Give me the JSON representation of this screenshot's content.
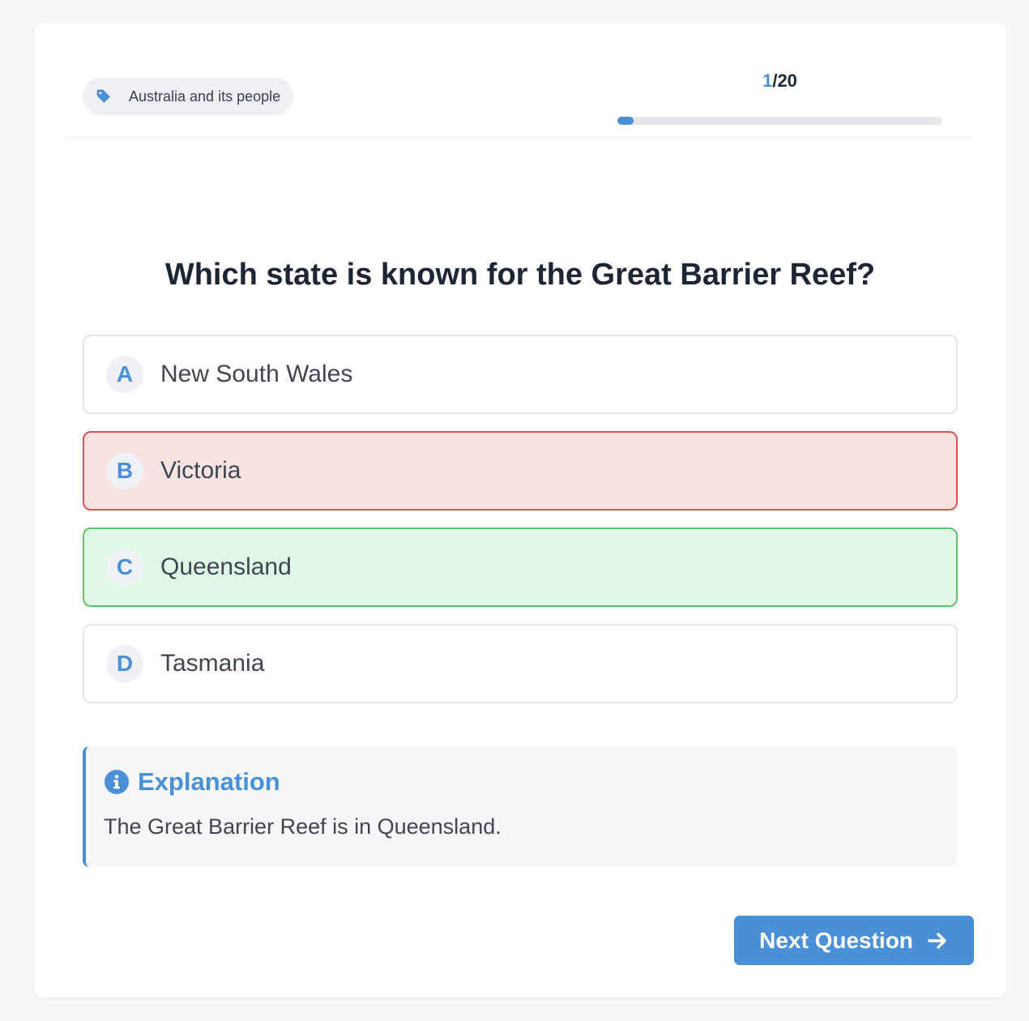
{
  "category": {
    "icon": "tag-icon",
    "label": "Australia and its people"
  },
  "progress": {
    "current": "1",
    "separator": "/",
    "total": "20",
    "fraction": 0.05
  },
  "question": "Which state is known for the Great Barrier Reef?",
  "options": [
    {
      "letter": "A",
      "text": "New South Wales",
      "state": "default"
    },
    {
      "letter": "B",
      "text": "Victoria",
      "state": "incorrect"
    },
    {
      "letter": "C",
      "text": "Queensland",
      "state": "correct"
    },
    {
      "letter": "D",
      "text": "Tasmania",
      "state": "default"
    }
  ],
  "explanation": {
    "icon": "info-icon",
    "title": "Explanation",
    "text": "The Great Barrier Reef is in Queensland."
  },
  "next_button": {
    "label": "Next Question",
    "icon": "arrow-right-icon"
  },
  "colors": {
    "accent": "#4a90d9",
    "incorrect_bg": "#f8e3e2",
    "incorrect_border": "#dc5250",
    "correct_bg": "#e0f8e6",
    "correct_border": "#5fc46a"
  }
}
